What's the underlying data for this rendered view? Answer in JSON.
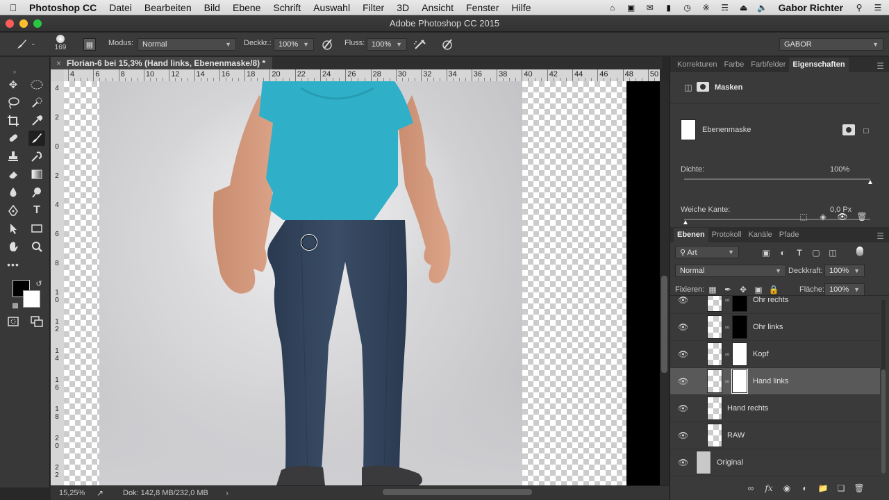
{
  "menubar": {
    "app": "Photoshop CC",
    "items": [
      "Datei",
      "Bearbeiten",
      "Bild",
      "Ebene",
      "Schrift",
      "Auswahl",
      "Filter",
      "3D",
      "Ansicht",
      "Fenster",
      "Hilfe"
    ],
    "user": "Gabor Richter"
  },
  "window": {
    "title": "Adobe Photoshop CC 2015"
  },
  "options": {
    "brush_size": "169",
    "mode_label": "Modus:",
    "mode_value": "Normal",
    "opacity_label": "Deckkr.:",
    "opacity_value": "100%",
    "flow_label": "Fluss:",
    "flow_value": "100%",
    "workspace": "GABOR"
  },
  "document": {
    "tab_title": "Florian-6 bei 15,3% (Hand links, Ebenenmaske/8) *",
    "close_glyph": "×",
    "zoom": "15,25%",
    "doc_info": "Dok: 142,8 MB/232,0 MB"
  },
  "ruler": {
    "h_labels": [
      "4",
      "6",
      "8",
      "10",
      "12",
      "14",
      "16",
      "18",
      "20",
      "22",
      "24",
      "26",
      "28",
      "30",
      "32",
      "34",
      "36",
      "38",
      "40",
      "42",
      "44",
      "46",
      "48",
      "50"
    ],
    "v_labels": [
      "4",
      "2",
      "0",
      "2",
      "4",
      "6",
      "8",
      "1\n0",
      "1\n2",
      "1\n4",
      "1\n6",
      "1\n8",
      "2\n0",
      "2\n2"
    ]
  },
  "properties_panel": {
    "tabs": [
      "Korrekturen",
      "Farbe",
      "Farbfelder",
      "Eigenschaften"
    ],
    "active_tab": "Eigenschaften",
    "section_title": "Masken",
    "mask_label": "Ebenenmaske",
    "density_label": "Dichte:",
    "density_value": "100%",
    "density_level": 1.0,
    "feather_label": "Weiche Kante:",
    "feather_value": "0,0 Px",
    "feather_level": 0.0
  },
  "layers_panel": {
    "tabs": [
      "Ebenen",
      "Protokoll",
      "Kanäle",
      "Pfade"
    ],
    "active_tab": "Ebenen",
    "filter_kind": "Art",
    "blend_mode": "Normal",
    "opacity_label": "Deckkraft:",
    "opacity_value": "100%",
    "lock_label": "Fixieren:",
    "fill_label": "Fläche:",
    "fill_value": "100%",
    "layers": [
      {
        "name": "Ohr rechts",
        "mask": "black"
      },
      {
        "name": "Ohr links",
        "mask": "black"
      },
      {
        "name": "Kopf",
        "mask": "white"
      },
      {
        "name": "Hand links",
        "mask": "white",
        "selected": true
      },
      {
        "name": "Hand rechts",
        "mask": "none"
      },
      {
        "name": "RAW",
        "mask": "none"
      },
      {
        "name": "Original",
        "mask": "none"
      }
    ]
  },
  "colors": {
    "foreground": "#000000",
    "background": "#ffffff",
    "shirt": "#2fb0c8",
    "jeans": "#2e3f55"
  }
}
